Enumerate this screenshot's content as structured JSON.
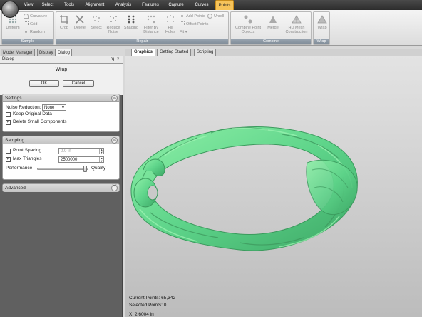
{
  "menu": {
    "items": [
      "View",
      "Select",
      "Tools",
      "Alignment",
      "Analysis",
      "Features",
      "Capture",
      "Curves",
      "Points"
    ],
    "active": "Points"
  },
  "ribbon": {
    "sample": {
      "title": "Sample",
      "uniform": "Uniform",
      "curvature": "Curvature",
      "grid": "Grid",
      "random": "Random"
    },
    "repair": {
      "title": "Repair",
      "crop": "Crop",
      "delete": "Delete",
      "select": "Select",
      "reduce_noise": "Reduce Noise",
      "shading": "Shading",
      "filter_by_distance": "Filter By Distance",
      "fill_holes": "Fill Holes",
      "add_points": "Add Points",
      "unroll": "Unroll",
      "offset_points": "Offset Points",
      "fit": "Fit"
    },
    "combine": {
      "title": "Combine",
      "combine_point_objects": "Combine Point Objects",
      "merge": "Merge",
      "hd_mesh": "HD Mesh Construction"
    },
    "wrap": {
      "title": "Wrap",
      "wrap": "Wrap"
    }
  },
  "left_tabs": [
    "Model Manager",
    "Display",
    "Dialog"
  ],
  "left_tab_active": "Dialog",
  "panel": {
    "title": "Dialog",
    "pin": "ʮ",
    "close": "×",
    "dialog_title": "Wrap",
    "ok": "OK",
    "cancel": "Cancel",
    "settings": {
      "title": "Settings",
      "noise_reduction_label": "Noise Reduction:",
      "noise_reduction_value": "None",
      "keep_original": "Keep Original Data",
      "keep_original_checked": false,
      "delete_small": "Delete Small Components",
      "delete_small_checked": true
    },
    "sampling": {
      "title": "Sampling",
      "point_spacing": "Point Spacing",
      "point_spacing_checked": false,
      "point_spacing_value": "0.0 in",
      "max_triangles": "Max Triangles",
      "max_triangles_checked": true,
      "max_triangles_value": "2500000",
      "performance": "Performance",
      "quality": "Quality",
      "quality_level": 0.95
    },
    "advanced": {
      "title": "Advanced"
    }
  },
  "viewport": {
    "tabs": [
      "Graphics",
      "Getting Started",
      "Scripting"
    ],
    "active_tab": "Graphics",
    "current_points": "Current Points: 65,342",
    "selected_points": "Selected Points: 0",
    "coord": "X: 2.6004 in"
  },
  "colors": {
    "active_tab": "#f6c35a",
    "model": "#5ed48a",
    "group_title": "#8894a0"
  }
}
